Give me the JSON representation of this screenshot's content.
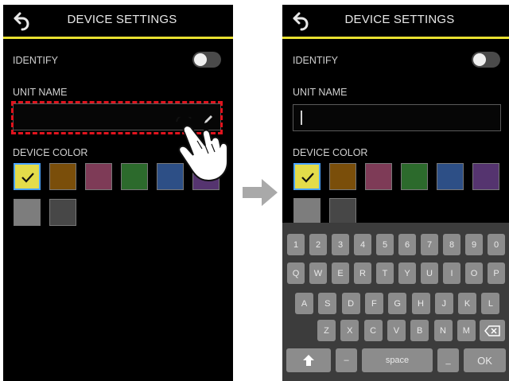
{
  "left_screen": {
    "title": "DEVICE SETTINGS",
    "back_icon": "back-arrow-icon",
    "identify_label": "IDENTIFY",
    "identify_on": false,
    "unit_name_label": "UNIT NAME",
    "unit_name_value": "",
    "device_color_label": "DEVICE COLOR"
  },
  "right_screen": {
    "title": "DEVICE SETTINGS",
    "back_icon": "back-arrow-icon",
    "identify_label": "IDENTIFY",
    "identify_on": false,
    "unit_name_label": "UNIT NAME",
    "unit_name_value": "",
    "device_color_label": "DEVICE COLOR"
  },
  "colors": {
    "accent_line": "#e8e030",
    "highlight_dashed": "#e0141e",
    "selected_border": "#4aa3ff",
    "swatches": [
      "#e3dc4a",
      "#7a4e0a",
      "#7e3b57",
      "#2c6a2c",
      "#2d4f86",
      "#55346f",
      "#7d7d7d",
      "#474747"
    ],
    "selected_swatch_index": 0
  },
  "icons": [
    "back-arrow-icon",
    "pencil-icon",
    "check-icon",
    "tapping-hand-icon",
    "right-arrow-icon",
    "shift-icon",
    "backspace-icon"
  ],
  "keyboard": {
    "row1": [
      "1",
      "2",
      "3",
      "4",
      "5",
      "6",
      "7",
      "8",
      "9",
      "0"
    ],
    "row2": [
      "Q",
      "W",
      "E",
      "R",
      "T",
      "Y",
      "U",
      "I",
      "O",
      "P"
    ],
    "row3": [
      "A",
      "S",
      "D",
      "F",
      "G",
      "H",
      "J",
      "K",
      "L"
    ],
    "row4": [
      "Z",
      "X",
      "C",
      "V",
      "B",
      "N",
      "M"
    ],
    "dash_key": "–",
    "space_key": "space",
    "underscore_key": "_",
    "ok_key": "OK"
  }
}
